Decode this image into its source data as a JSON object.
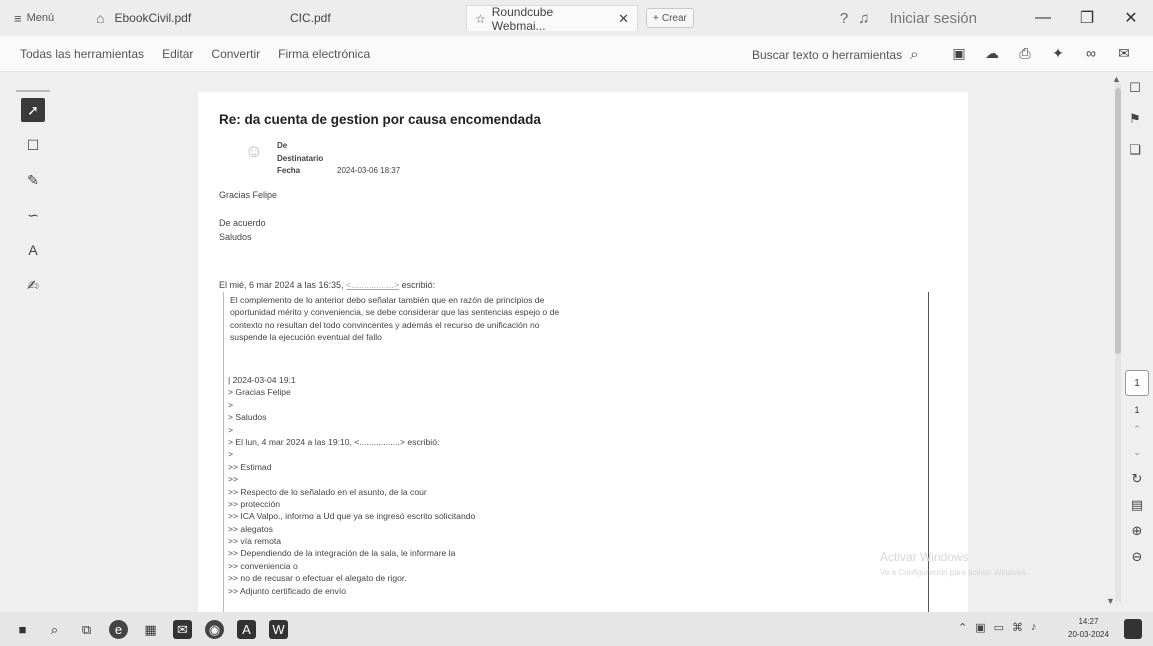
{
  "tabbar": {
    "menu_label": "Menú",
    "tabs": [
      {
        "label": "EbookCivil.pdf",
        "active": false
      },
      {
        "label": "CIC.pdf",
        "active": false
      },
      {
        "label": "Roundcube Webmai...",
        "active": true
      }
    ],
    "new_tab_label": "Crear",
    "signin_label": "Iniciar sesión"
  },
  "toolbar": {
    "all_tools": "Todas las herramientas",
    "edit": "Editar",
    "convert": "Convertir",
    "esign": "Firma electrónica",
    "search_label": "Buscar texto o herramientas"
  },
  "email": {
    "subject": "Re: da cuenta de gestion por causa encomendada",
    "header_labels": {
      "from": "De",
      "to": "Destinatario",
      "date": "Fecha"
    },
    "date_value": "2024-03-06 18:37",
    "body_lines": [
      "Gracias Felipe",
      "De acuerdo",
      "Saludos"
    ],
    "quote_intro_start": "El mié, 6 mar 2024 a las 16:35,",
    "quote_intro_email": "<.................>",
    "quote_intro_end": "escribió:",
    "quoted_paragraph": "El complemento de lo anterior debo señalar también que en razón de principios de oportunidad mérito y conveniencia, se debe considerar que las sentencias espejo o de contexto no resultan del todo convincentes y además el recurso de unificación no suspende la ejecución eventual del fallo",
    "quoted_lines": [
      "| 2024-03-04 19:1",
      "> Gracias Felipe",
      ">",
      "> Saludos",
      ">",
      "> El lun, 4 mar 2024 a las 19:10, <.................> escribió:",
      ">",
      ">> Estimad",
      ">>",
      ">> Respecto de lo señalado en el asunto, de la cour",
      ">> protección",
      ">> ICA Valpo., informo a Ud que ya se ingresó escrito solicitando",
      ">> alegatos",
      ">> vía remota",
      ">> Dependiendo de la integración de la sala, le informare la",
      ">> conveniencia o",
      ">> no de recusar o efectuar el alegato de rigor.",
      ">> Adjunto certificado de envío"
    ]
  },
  "right_panel": {
    "page_current": "1",
    "page_total": "1"
  },
  "watermark": {
    "line1": "Activar Windows",
    "line2": "Ve a Configuración para activar Windows."
  },
  "taskbar": {
    "time": "14:27",
    "date": "20-03-2024"
  }
}
